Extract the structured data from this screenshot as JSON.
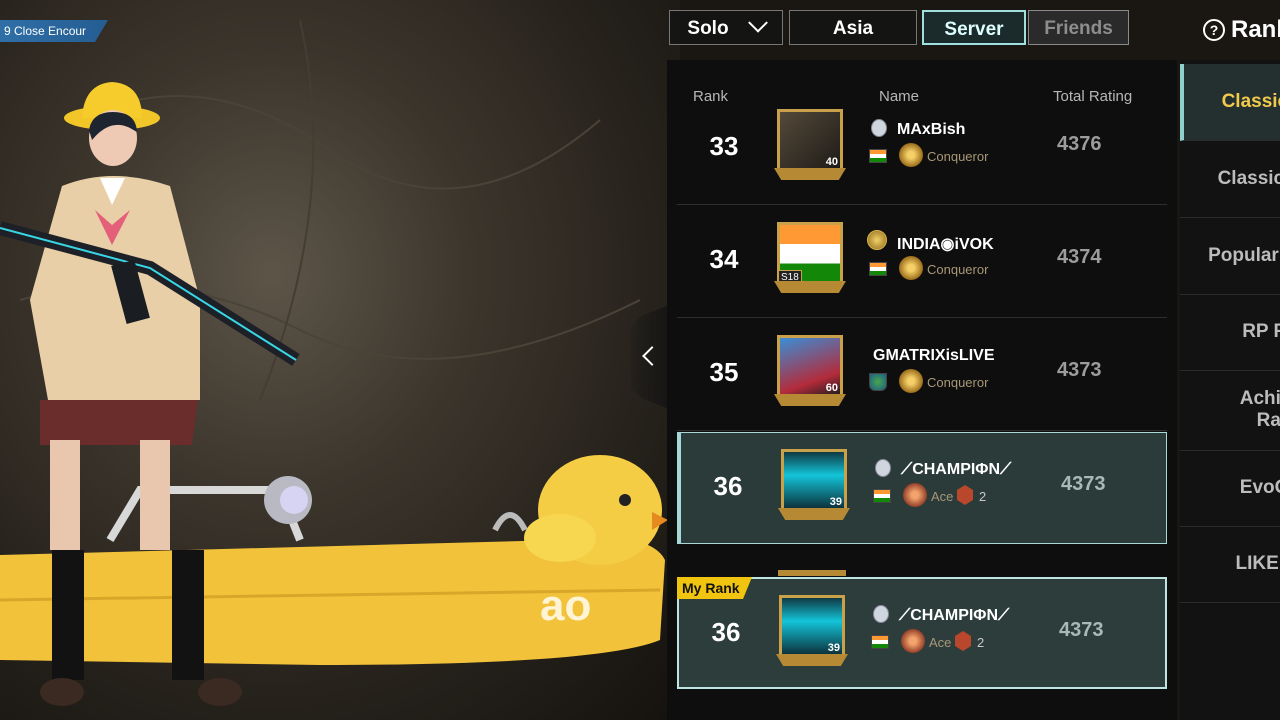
{
  "top_left_tag": "9 Close Encour",
  "filters": {
    "mode": "Solo",
    "region": "Asia",
    "server": "Server",
    "friends": "Friends"
  },
  "page_title": "Rank",
  "columns": {
    "rank": "Rank",
    "name": "Name",
    "rating": "Total Rating"
  },
  "rows": [
    {
      "rank": "33",
      "name": "MAxBish",
      "tier": "Conqueror",
      "rating": "4376",
      "avatar_level": "40"
    },
    {
      "rank": "34",
      "name": "INDIA◉iVOK",
      "tier": "Conqueror",
      "rating": "4374",
      "avatar_badge": "S18"
    },
    {
      "rank": "35",
      "name": "GMATRIXisLIVE",
      "tier": "Conqueror",
      "rating": "4373",
      "avatar_level": "60"
    },
    {
      "rank": "36",
      "name": "⟋CHAMPIΦN⟋",
      "tier": "Ace",
      "ace_level": "2",
      "rating": "4373",
      "avatar_level": "39"
    }
  ],
  "my_rank": {
    "tag": "My Rank",
    "rank": "36",
    "name": "⟋CHAMPIΦN⟋",
    "tier": "Ace",
    "ace_level": "2",
    "rating": "4373",
    "avatar_level": "39"
  },
  "categories": [
    "Classic (TP",
    "Classic (FP",
    "Popularity C",
    "RP Rank",
    "Achiever Rankin",
    "EvoGrou",
    "LIKE Ran"
  ],
  "colors": {
    "accent": "#9fe0df",
    "gold": "#f2c94c",
    "my_rank_tag": "#f1c40f"
  },
  "icons": [
    "help-icon",
    "chevron-down-icon",
    "chevron-left-icon",
    "conqueror-icon",
    "ace-icon",
    "india-flag-icon"
  ]
}
